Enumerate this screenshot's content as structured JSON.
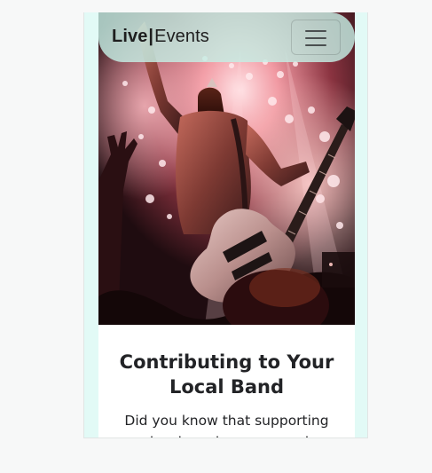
{
  "navbar": {
    "brand_bold": "Live",
    "brand_separator": "|",
    "brand_light": "Events",
    "menu_icon": "hamburger-icon"
  },
  "hero": {
    "image": "rock guitarist on stage with raised fist, stage lights, crowd silhouettes"
  },
  "article": {
    "title": "Contributing to Your Local Band",
    "text": "Did you know that supporting your local music scene can have a"
  },
  "colors": {
    "page_background": "#f7f8f8",
    "frame_background": "#e2faf6",
    "navbar_background": "#c4eee4",
    "text": "#222326"
  }
}
